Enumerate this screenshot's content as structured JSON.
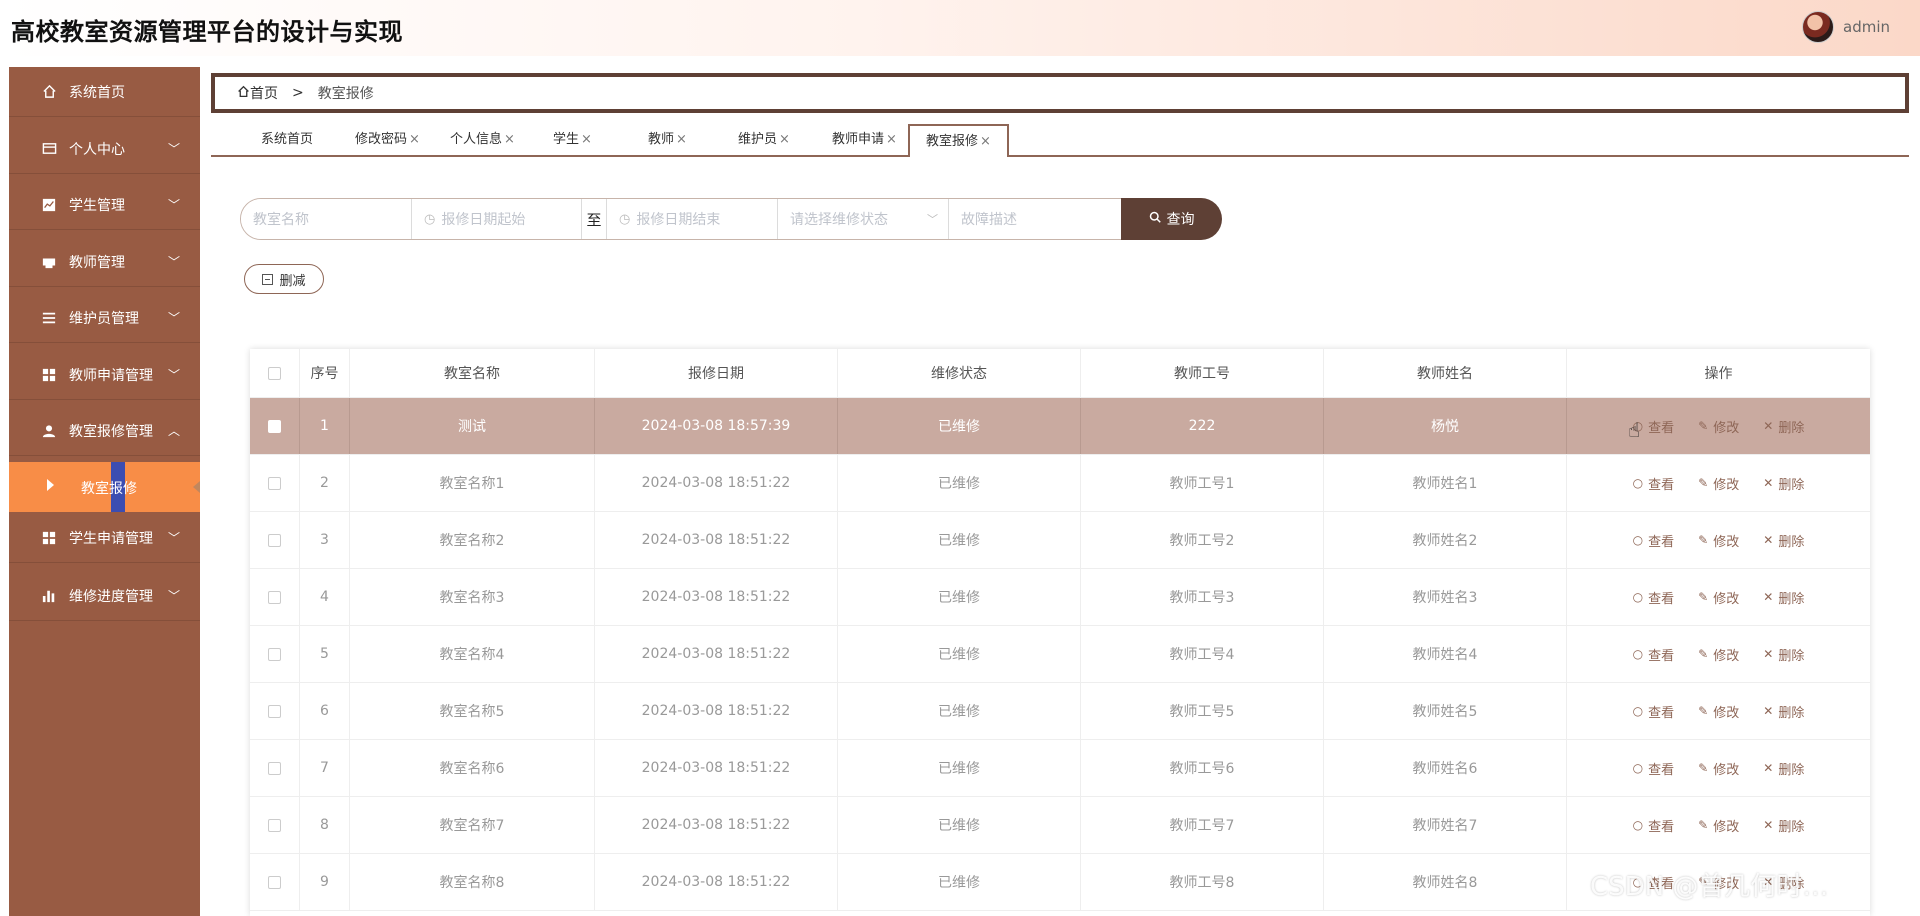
{
  "app": {
    "title": "高校教室资源管理平台的设计与实现",
    "user": "admin"
  },
  "sidebar": {
    "items": [
      {
        "label": "系统首页",
        "icon": "home-icon",
        "chevron": ""
      },
      {
        "label": "个人中心",
        "icon": "card-icon",
        "chevron": "﹀"
      },
      {
        "label": "学生管理",
        "icon": "chart-icon",
        "chevron": "﹀"
      },
      {
        "label": "教师管理",
        "icon": "printer-icon",
        "chevron": "﹀"
      },
      {
        "label": "维护员管理",
        "icon": "list-icon",
        "chevron": "﹀"
      },
      {
        "label": "教师申请管理",
        "icon": "grid-icon",
        "chevron": "﹀"
      },
      {
        "label": "教室报修管理",
        "icon": "user-icon",
        "chevron": "︿"
      },
      {
        "label": "学生申请管理",
        "icon": "grid-icon",
        "chevron": "﹀"
      },
      {
        "label": "维修进度管理",
        "icon": "bar-chart-icon",
        "chevron": "﹀"
      }
    ],
    "sub_item": "教室报修"
  },
  "breadcrumb": {
    "home": "首页",
    "sep": ">",
    "current": "教室报修"
  },
  "tabs": [
    {
      "label": "系统首页",
      "close": ""
    },
    {
      "label": "修改密码",
      "close": "×"
    },
    {
      "label": "个人信息",
      "close": "×"
    },
    {
      "label": "学生",
      "close": "×"
    },
    {
      "label": "教师",
      "close": "×"
    },
    {
      "label": "维护员",
      "close": "×"
    },
    {
      "label": "教师申请",
      "close": "×"
    },
    {
      "label": "教室报修",
      "close": "×"
    }
  ],
  "search": {
    "classroom_placeholder": "教室名称",
    "date_start_placeholder": "报修日期起始",
    "to": "至",
    "date_end_placeholder": "报修日期结束",
    "status_placeholder": "请选择维修状态",
    "fault_placeholder": "故障描述",
    "button": "查询"
  },
  "actions": {
    "delete": "删减"
  },
  "table": {
    "headers": [
      "序号",
      "教室名称",
      "报修日期",
      "维修状态",
      "教师工号",
      "教师姓名",
      "操作"
    ],
    "op_view": "查看",
    "op_edit": "修改",
    "op_delete": "删除",
    "rows": [
      {
        "no": "1",
        "name": "测试",
        "date": "2024-03-08 18:57:39",
        "status": "已维修",
        "tid": "222",
        "tname": "杨悦"
      },
      {
        "no": "2",
        "name": "教室名称1",
        "date": "2024-03-08 18:51:22",
        "status": "已维修",
        "tid": "教师工号1",
        "tname": "教师姓名1"
      },
      {
        "no": "3",
        "name": "教室名称2",
        "date": "2024-03-08 18:51:22",
        "status": "已维修",
        "tid": "教师工号2",
        "tname": "教师姓名2"
      },
      {
        "no": "4",
        "name": "教室名称3",
        "date": "2024-03-08 18:51:22",
        "status": "已维修",
        "tid": "教师工号3",
        "tname": "教师姓名3"
      },
      {
        "no": "5",
        "name": "教室名称4",
        "date": "2024-03-08 18:51:22",
        "status": "已维修",
        "tid": "教师工号4",
        "tname": "教师姓名4"
      },
      {
        "no": "6",
        "name": "教室名称5",
        "date": "2024-03-08 18:51:22",
        "status": "已维修",
        "tid": "教师工号5",
        "tname": "教师姓名5"
      },
      {
        "no": "7",
        "name": "教室名称6",
        "date": "2024-03-08 18:51:22",
        "status": "已维修",
        "tid": "教师工号6",
        "tname": "教师姓名6"
      },
      {
        "no": "8",
        "name": "教室名称7",
        "date": "2024-03-08 18:51:22",
        "status": "已维修",
        "tid": "教师工号7",
        "tname": "教师姓名7"
      },
      {
        "no": "9",
        "name": "教室名称8",
        "date": "2024-03-08 18:51:22",
        "status": "已维修",
        "tid": "教师工号8",
        "tname": "教师姓名8"
      }
    ]
  },
  "watermark": "CSDN @曾几何时…",
  "colors": {
    "sidebar": "#985b43",
    "accent": "#5e4035",
    "active_sub": "#f88d47",
    "highlight_row": "#c9aaa0"
  }
}
